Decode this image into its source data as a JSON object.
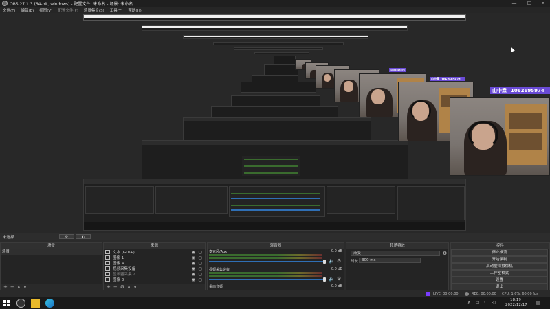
{
  "window": {
    "title": "OBS 27.1.3 (64-bit, windows) - 配置文件: 未命名 - 场景: 未命名"
  },
  "menu": [
    "文件(F)",
    "编辑(E)",
    "视图(V)",
    "配置文件(P)",
    "场景集合(S)",
    "工具(T)",
    "帮助(H)"
  ],
  "overlay": {
    "badge_name": "山中霖",
    "badge_id": "1062695974",
    "colors": {
      "badge": "#6a4bd6"
    }
  },
  "transition_label": "未选择",
  "docks": {
    "scenes": {
      "title": "场景",
      "items": [
        "场景"
      ]
    },
    "sources": {
      "title": "来源",
      "items": [
        {
          "icon": "text-icon",
          "label": "文本 (GDI+)"
        },
        {
          "icon": "image-icon",
          "label": "图像 1"
        },
        {
          "icon": "image-icon",
          "label": "图像 4"
        },
        {
          "icon": "video-capture-icon",
          "label": "视频采集设备"
        },
        {
          "icon": "display-capture-icon",
          "label": "显示器采集 2"
        },
        {
          "icon": "image-icon",
          "label": "图像 3"
        }
      ]
    },
    "mixer": {
      "title": "混音器",
      "channels": [
        {
          "name": "麦克风/Aux",
          "db": "0.0 dB"
        },
        {
          "name": "视频采集设备",
          "db": "0.0 dB"
        },
        {
          "name": "桌面音频",
          "db": "0.0 dB"
        }
      ]
    },
    "transitions": {
      "title": "转场特效",
      "selected": "渐变",
      "duration_label": "时长",
      "duration_value": "300 ms"
    },
    "controls": {
      "title": "控件",
      "buttons": [
        "停止推流",
        "开始录制",
        "启动虚拟摄像机",
        "工作室模式",
        "设置",
        "退出"
      ]
    }
  },
  "footer": {
    "plus": "+",
    "minus": "−",
    "up": "∧",
    "down": "∨",
    "gear": "⚙"
  },
  "statusbar": {
    "live": "LIVE: 00:00:00",
    "rec": "REC: 00:00:00",
    "cpu": "CPU: 1.6%, 60.00 fps"
  },
  "taskbar": {
    "time": "18:19",
    "date": "2022/12/17"
  }
}
